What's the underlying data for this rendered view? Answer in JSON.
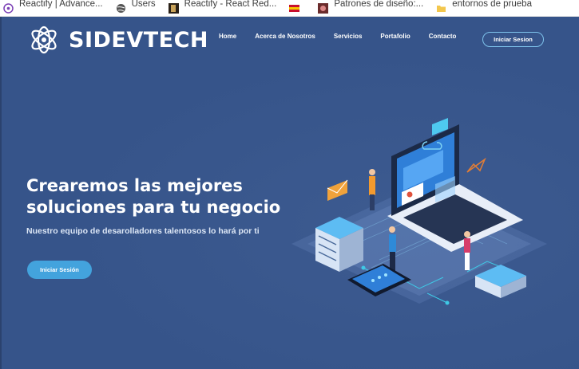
{
  "bookmarks": [
    {
      "label": "Reactify | Advance...",
      "icon": "reactify-icon"
    },
    {
      "label": "Users",
      "icon": "globe-icon"
    },
    {
      "label": "Reactify - React Red...",
      "icon": "reactify-thumbnail-icon"
    },
    {
      "label": "",
      "icon": "flag-icon"
    },
    {
      "label": "Patrones de diseño:...",
      "icon": "patrones-icon"
    },
    {
      "label": "entornos de prueba",
      "icon": "folder-icon"
    }
  ],
  "brand": {
    "name": "SIDEVTECH",
    "logo_icon": "atom-logo-icon"
  },
  "nav": {
    "items": [
      "Home",
      "Acerca de Nosotros",
      "Servicios",
      "Portafolio",
      "Contacto"
    ],
    "login_label": "Iniciar Sesion"
  },
  "hero": {
    "headline_line1": "Crearemos las mejores",
    "headline_line2": "soluciones para tu negocio",
    "subline": "Nuestro equipo de desarolladores talentosos lo hará por ti",
    "cta_label": "Iniciar Sesión"
  },
  "colors": {
    "background": "#36548a",
    "accent": "#43a3dd",
    "button_border": "#7ec3ec"
  }
}
